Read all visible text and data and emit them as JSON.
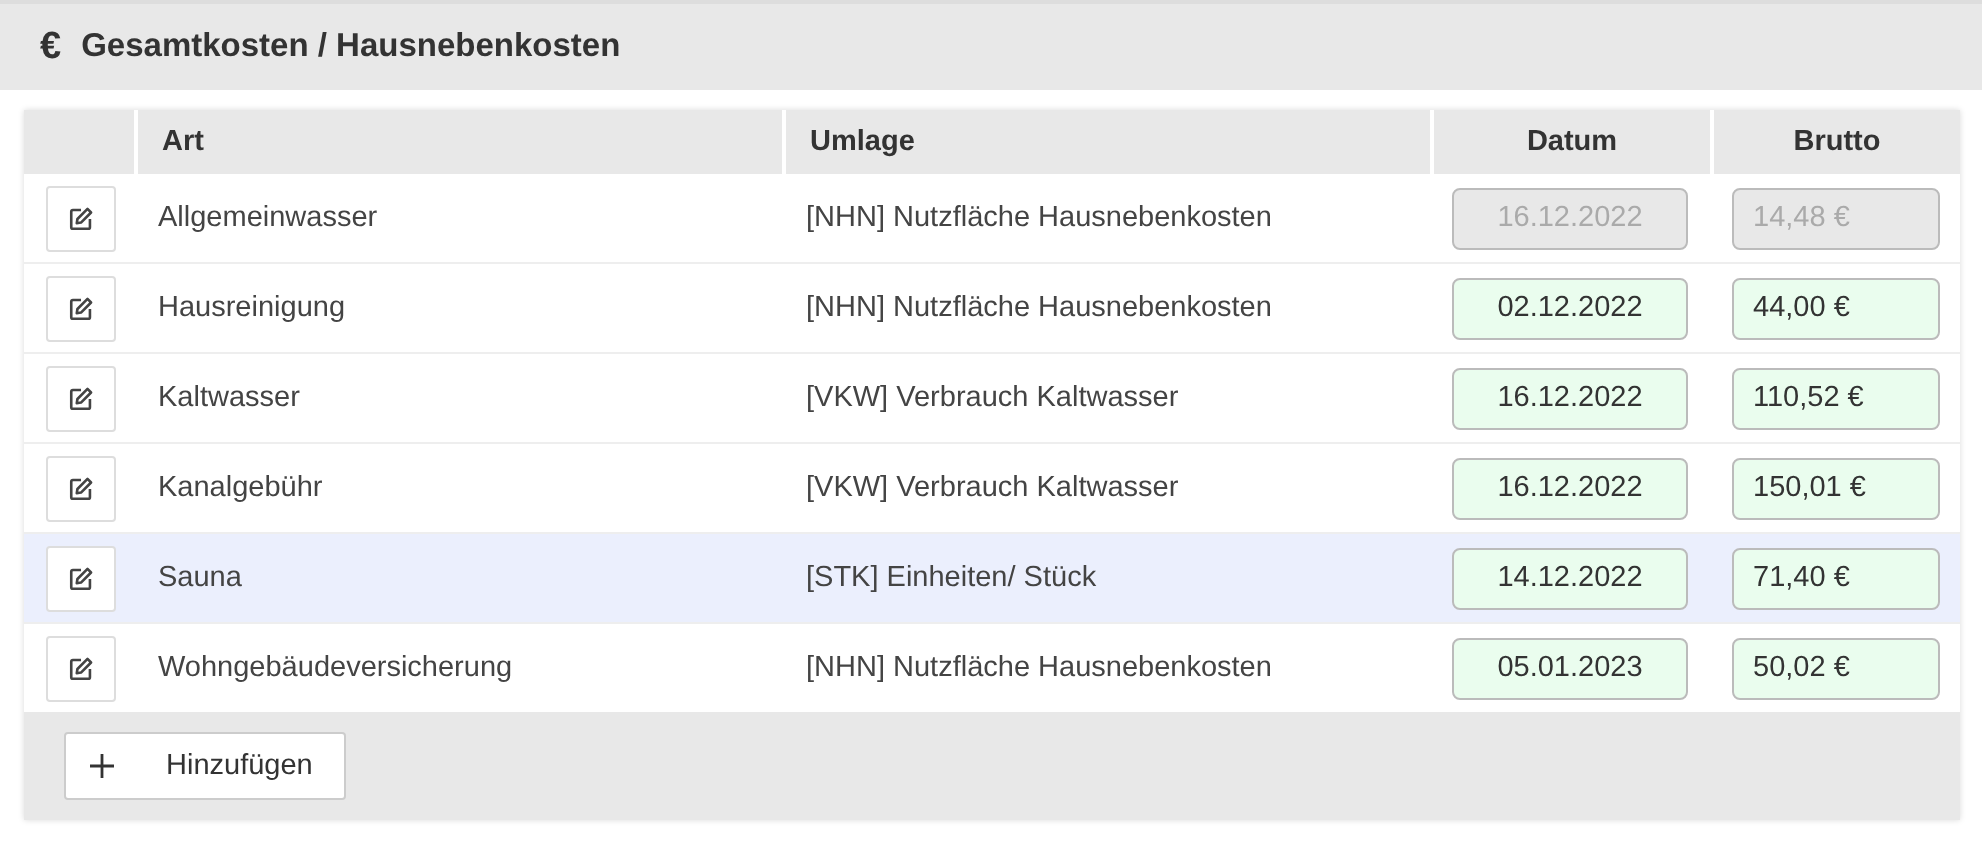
{
  "header": {
    "icon": "€",
    "title": "Gesamtkosten / Hausnebenkosten"
  },
  "table": {
    "columns": [
      "Art",
      "Umlage",
      "Datum",
      "Brutto"
    ],
    "rows": [
      {
        "art": "Allgemeinwasser",
        "umlage": "[NHN] Nutzfläche Hausnebenkosten",
        "datum": "16.12.2022",
        "brutto": "14,48 €",
        "disabled": true,
        "selected": false
      },
      {
        "art": "Hausreinigung",
        "umlage": "[NHN] Nutzfläche Hausnebenkosten",
        "datum": "02.12.2022",
        "brutto": "44,00 €",
        "disabled": false,
        "selected": false
      },
      {
        "art": "Kaltwasser",
        "umlage": "[VKW] Verbrauch Kaltwasser",
        "datum": "16.12.2022",
        "brutto": "110,52 €",
        "disabled": false,
        "selected": false
      },
      {
        "art": "Kanalgebühr",
        "umlage": "[VKW] Verbrauch Kaltwasser",
        "datum": "16.12.2022",
        "brutto": "150,01 €",
        "disabled": false,
        "selected": false
      },
      {
        "art": "Sauna",
        "umlage": "[STK] Einheiten/ Stück",
        "datum": "14.12.2022",
        "brutto": "71,40 €",
        "disabled": false,
        "selected": true
      },
      {
        "art": "Wohngebäudeversicherung",
        "umlage": "[NHN] Nutzfläche Hausnebenkosten",
        "datum": "05.01.2023",
        "brutto": "50,02 €",
        "disabled": false,
        "selected": false
      }
    ]
  },
  "add_button": {
    "label": "Hinzufügen"
  }
}
